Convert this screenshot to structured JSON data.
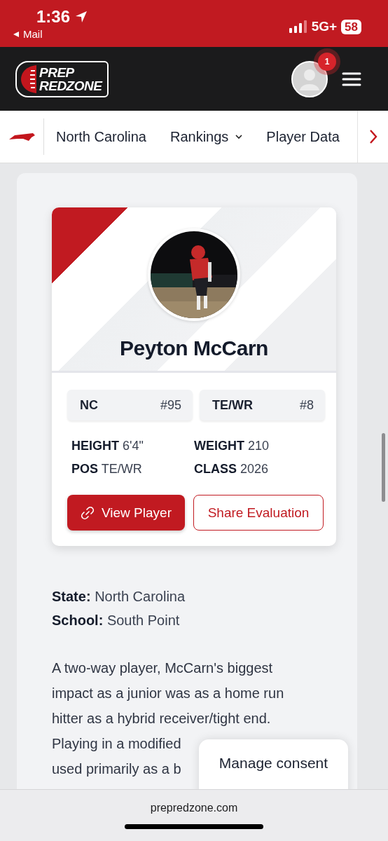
{
  "status_bar": {
    "time": "1:36",
    "back_label": "Mail",
    "network": "5G+",
    "battery": "58"
  },
  "header": {
    "logo_lines": [
      "PREP",
      "REDZONE"
    ],
    "notification_count": "1"
  },
  "nav": {
    "items": [
      {
        "label": "North Carolina",
        "has_dropdown": false
      },
      {
        "label": "Rankings",
        "has_dropdown": true
      },
      {
        "label": "Player Data",
        "has_dropdown": false
      }
    ]
  },
  "profile": {
    "name": "Peyton McCarn",
    "ranks": [
      {
        "label": "NC",
        "value": "#95"
      },
      {
        "label": "TE/WR",
        "value": "#8"
      }
    ],
    "attributes": [
      {
        "label": "HEIGHT",
        "value": "6'4\""
      },
      {
        "label": "WEIGHT",
        "value": "210"
      },
      {
        "label": "POS",
        "value": "TE/WR"
      },
      {
        "label": "CLASS",
        "value": "2026"
      }
    ],
    "buttons": [
      {
        "label": "View Player",
        "kind": "primary"
      },
      {
        "label": "Share Evaluation",
        "kind": "outline"
      }
    ]
  },
  "details": [
    {
      "label": "State:",
      "value": "North Carolina"
    },
    {
      "label": "School:",
      "value": "South Point"
    }
  ],
  "paragraph_lines": [
    "A two-way player, McCarn's biggest",
    "impact as a junior was as a home run",
    "hitter as a hybrid receiver/tight end.",
    "Playing in a modified",
    "used primarily as a b"
  ],
  "consent": {
    "label": "Manage consent"
  },
  "browser": {
    "url": "prepredzone.com"
  }
}
